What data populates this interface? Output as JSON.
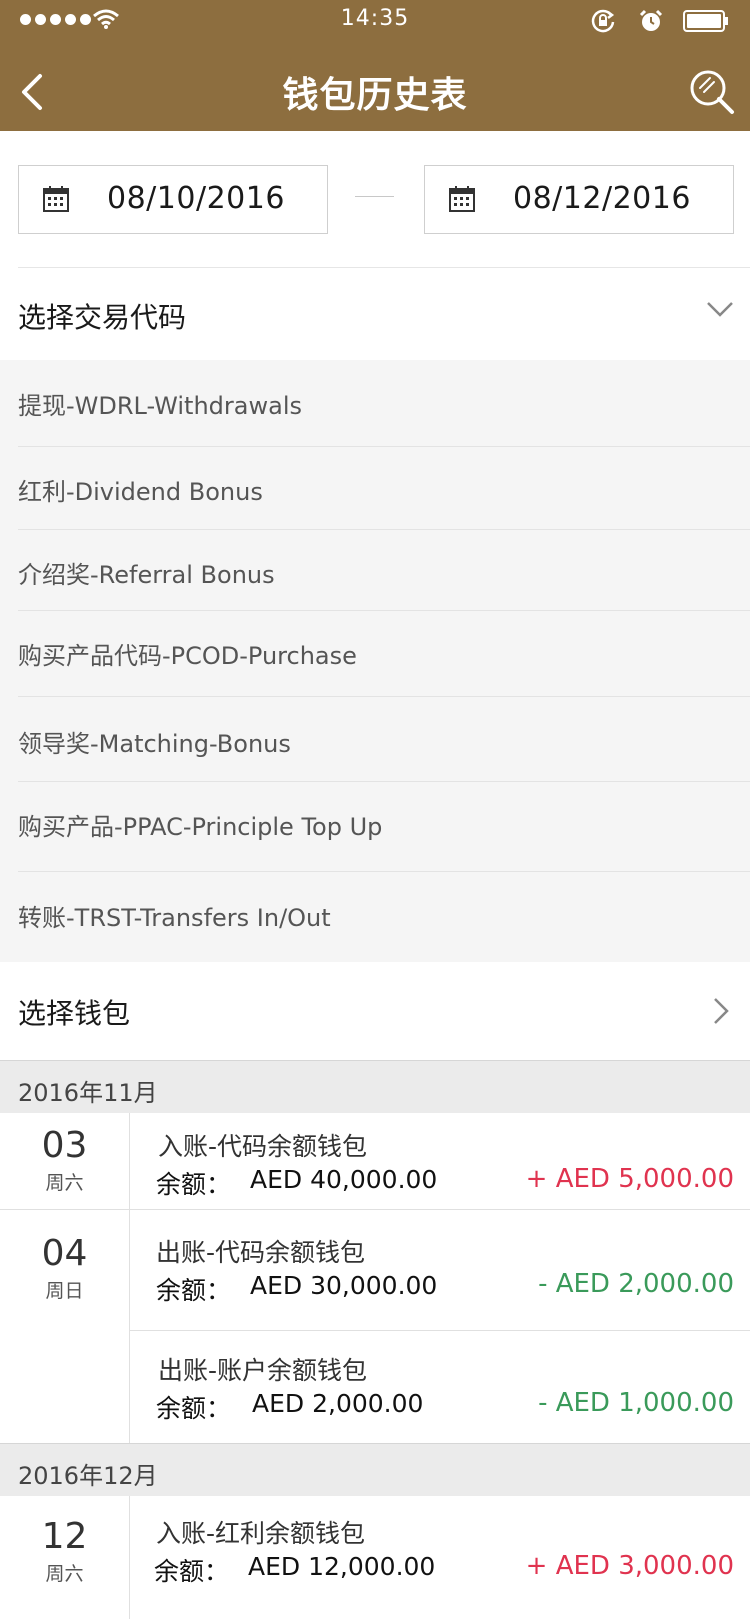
{
  "status_bar": {
    "time": "14:35"
  },
  "header": {
    "title": "钱包历史表"
  },
  "date_range": {
    "from": "08/10/2016",
    "to": "08/12/2016"
  },
  "transaction_code": {
    "label": "选择交易代码",
    "options": [
      "提现-WDRL-Withdrawals",
      "红利-Dividend Bonus",
      "介绍奖-Referral Bonus",
      "购买产品代码-PCOD-Purchase",
      "领导奖-Matching-Bonus",
      "购买产品-PPAC-Principle Top Up",
      "转账-TRST-Transfers In/Out"
    ]
  },
  "wallet_select": {
    "label": "选择钱包"
  },
  "balance_label": "余额：",
  "months": [
    {
      "label": "2016年11月",
      "days": [
        {
          "day": "03",
          "weekday": "周六",
          "transactions": [
            {
              "title": "入账-代码余额钱包",
              "balance": "AED 40,000.00",
              "amount": "+ AED 5,000.00",
              "direction": "in"
            }
          ]
        },
        {
          "day": "04",
          "weekday": "周日",
          "transactions": [
            {
              "title": "出账-代码余额钱包",
              "balance": "AED 30,000.00",
              "amount": "-  AED 2,000.00",
              "direction": "out"
            },
            {
              "title": "出账-账户余额钱包",
              "balance": "AED 2,000.00",
              "amount": "-  AED 1,000.00",
              "direction": "out"
            }
          ]
        }
      ]
    },
    {
      "label": "2016年12月",
      "days": [
        {
          "day": "12",
          "weekday": "周六",
          "transactions": [
            {
              "title": "入账-红利余额钱包",
              "balance": "AED 12,000.00",
              "amount": "+ AED 3,000.00",
              "direction": "in"
            }
          ]
        }
      ]
    }
  ],
  "colors": {
    "header": "#8d6e3f",
    "positive": "#e0334f",
    "negative": "#3a9a5a"
  },
  "icons": [
    "signal-icon",
    "wifi-icon",
    "rotation-lock-icon",
    "alarm-icon",
    "battery-icon",
    "back-icon",
    "search-icon",
    "calendar-icon",
    "chevron-down-icon",
    "chevron-right-icon"
  ]
}
